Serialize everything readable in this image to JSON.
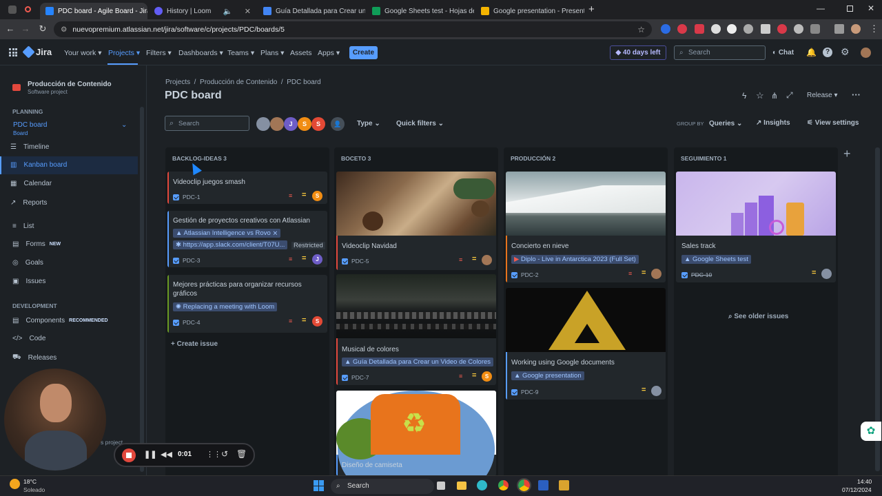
{
  "browser": {
    "tabs": [
      {
        "title": "PDC board - Agile Board - Jira",
        "color": "#2684ff"
      },
      {
        "title": "History | Loom",
        "color": "#625df5"
      },
      {
        "title": "Guía Detallada para Crear un V",
        "color": "#4285f4"
      },
      {
        "title": "Google Sheets test - Hojas de c",
        "color": "#0f9d58"
      },
      {
        "title": "Google presentation - Presenta",
        "color": "#f4b400"
      }
    ],
    "url": "nuevopremium.atlassian.net/jira/software/c/projects/PDC/boards/5"
  },
  "topnav": {
    "logo": "Jira",
    "items": [
      "Your work",
      "Projects",
      "Filters",
      "Dashboards",
      "Teams",
      "Plans",
      "Assets",
      "Apps"
    ],
    "create": "Create",
    "trial": "40 days left",
    "search_placeholder": "Search",
    "chat": "Chat"
  },
  "sidebar": {
    "project_name": "Producción de Contenido",
    "project_type": "Software project",
    "planning_label": "PLANNING",
    "board_name": "PDC board",
    "board_sub": "Board",
    "planning_items": [
      "Timeline",
      "Kanban board",
      "Calendar",
      "Reports"
    ],
    "other_items": [
      "List",
      "Forms",
      "Goals",
      "Issues"
    ],
    "forms_badge": "NEW",
    "development_label": "DEVELOPMENT",
    "dev_items": [
      "Components",
      "Code",
      "Releases"
    ],
    "components_badge": "RECOMMENDED",
    "footer_text": "s project"
  },
  "board": {
    "breadcrumb": [
      "Projects",
      "Producción de Contenido",
      "PDC board"
    ],
    "title": "PDC board",
    "search_placeholder": "Search",
    "filters": [
      "Type",
      "Quick filters"
    ],
    "group_by_label": "GROUP BY",
    "group_by_value": "Queries",
    "insights": "Insights",
    "view_settings": "View settings",
    "release": "Release",
    "avatars": [
      "J",
      "S",
      "S"
    ],
    "columns": [
      {
        "header": "BACKLOG-IDEAS 3"
      },
      {
        "header": "BOCETO 3"
      },
      {
        "header": "PRODUCCIÓN 2"
      },
      {
        "header": "SEGUIMIENTO 1"
      }
    ],
    "create_issue": "Create issue",
    "see_older": "See older issues",
    "cards": {
      "pdc1": {
        "title": "Videoclip juegos smash",
        "key": "PDC-1",
        "avatar": "S"
      },
      "pdc3": {
        "title": "Gestión de proyectos creativos con Atlassian",
        "link1": "Atlassian Intelligence vs Rovo",
        "link2": "https://app.slack.com/client/T07U...",
        "restricted": "Restricted",
        "key": "PDC-3",
        "avatar": "J"
      },
      "pdc4": {
        "title": "Mejores prácticas para organizar recursos",
        "title2": "gráficos",
        "link1": "Replacing a meeting with Loom",
        "key": "PDC-4",
        "avatar": "S"
      },
      "pdc5": {
        "title": "Videoclip Navidad",
        "key": "PDC-5"
      },
      "pdc7": {
        "title": "Musical de colores",
        "link1": "Guía Detallada para Crear un Video de Colores",
        "key": "PDC-7",
        "avatar": "S"
      },
      "pdc_camiseta": {
        "title": "Diseño de camiseta"
      },
      "pdc2": {
        "title": "Concierto en nieve",
        "link1": "Diplo - Live in Antarctica 2023 (Full Set)",
        "key": "PDC-2"
      },
      "pdc9": {
        "title": "Working using Google documents",
        "link1": "Google presentation",
        "key": "PDC-9"
      },
      "pdc10": {
        "title": "Sales track",
        "link1": "Google Sheets test",
        "key": "PDC-10"
      }
    }
  },
  "recorder": {
    "time": "0:01"
  },
  "taskbar": {
    "temp": "18°C",
    "weather": "Soleado",
    "search": "Search",
    "time": "14:40",
    "date": "07/12/2024"
  }
}
